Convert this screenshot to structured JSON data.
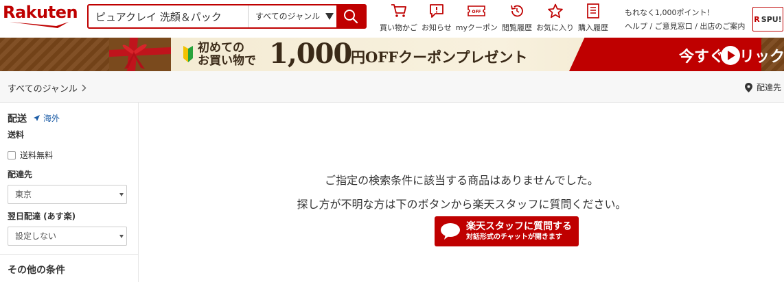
{
  "header": {
    "logo": "Rakuten",
    "search": {
      "value": "ピュアクレイ 洗顔＆パック",
      "genre": "すべてのジャンル"
    },
    "nav": [
      {
        "label": "買い物かご",
        "icon": "cart-icon"
      },
      {
        "label": "お知らせ",
        "icon": "notification-icon"
      },
      {
        "label": "myクーポン",
        "icon": "coupon-icon"
      },
      {
        "label": "閲覧履歴",
        "icon": "history-icon"
      },
      {
        "label": "お気に入り",
        "icon": "star-icon"
      },
      {
        "label": "購入履歴",
        "icon": "receipt-icon"
      }
    ],
    "promo_line": "もれなく1,000ポイント！",
    "help_links": "ヘルプ / ご意見窓口 / 出店のご案内",
    "spu": {
      "r": "R",
      "label": "SPU!"
    }
  },
  "banner": {
    "small_line1": "初めての",
    "small_line2": "お買い物で",
    "big": "1,000",
    "rest": "円OFFクーポンプレゼント",
    "cta": "今すぐクリック！"
  },
  "breadcrumb": {
    "label": "すべてのジャンル",
    "delivery": "配達先"
  },
  "sidebar": {
    "shipping_heading": "配送",
    "overseas": "海外",
    "fee_label": "送料",
    "free_shipping": "送料無料",
    "delivery_label": "配達先",
    "delivery_value": "東京",
    "nextday_label": "翌日配達 (あす楽)",
    "nextday_value": "設定しない",
    "other_heading": "その他の条件"
  },
  "main": {
    "message1": "ご指定の検索条件に該当する商品はありませんでした。",
    "message2": "探し方が不明な方は下のボタンから楽天スタッフに質問ください。",
    "ask_title": "楽天スタッフに質問する",
    "ask_sub": "対話形式のチャットが開きます"
  },
  "colors": {
    "brand": "#bf0000",
    "link": "#1a5ba6"
  }
}
